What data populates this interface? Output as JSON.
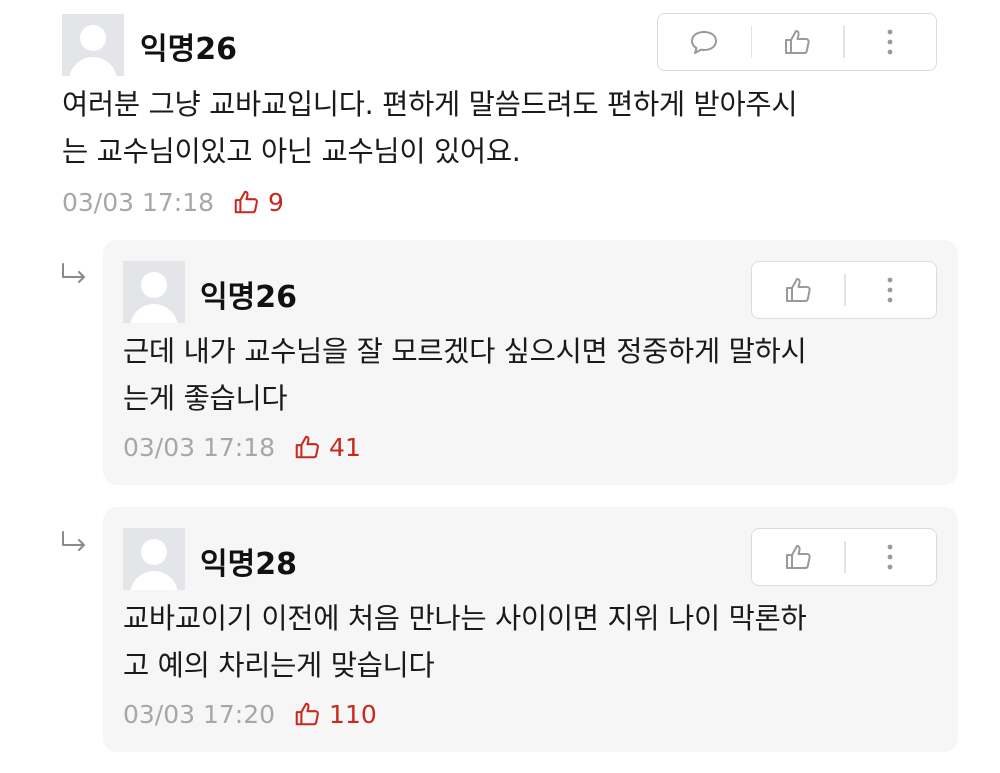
{
  "comments": [
    {
      "author": "익명26",
      "text_lines": [
        "여러분 그냥 교바교입니다. 편하게 말씀드려도 편하게 받아주시",
        "는 교수님이있고 아닌 교수님이 있어요."
      ],
      "time": "03/03 17:18",
      "likes": "9",
      "actions": [
        "comment-icon",
        "thumbs-up-icon",
        "more-vertical-icon"
      ]
    }
  ],
  "replies": [
    {
      "author": "익명26",
      "text_lines": [
        "근데 내가 교수님을 잘 모르겠다 싶으시면 정중하게 말하시",
        "는게 좋습니다"
      ],
      "time": "03/03 17:18",
      "likes": "41",
      "actions": [
        "thumbs-up-icon",
        "more-vertical-icon"
      ]
    },
    {
      "author": "익명28",
      "text_lines": [
        "교바교이기 이전에 처음 만나는 사이이면 지위 나이 막론하",
        "고 예의 차리는게 맞습니다"
      ],
      "time": "03/03 17:20",
      "likes": "110",
      "actions": [
        "thumbs-up-icon",
        "more-vertical-icon"
      ]
    }
  ],
  "colors": {
    "like_accent": "#c8281e",
    "meta_gray": "#a7a7a7",
    "reply_bg": "#f6f6f6"
  }
}
